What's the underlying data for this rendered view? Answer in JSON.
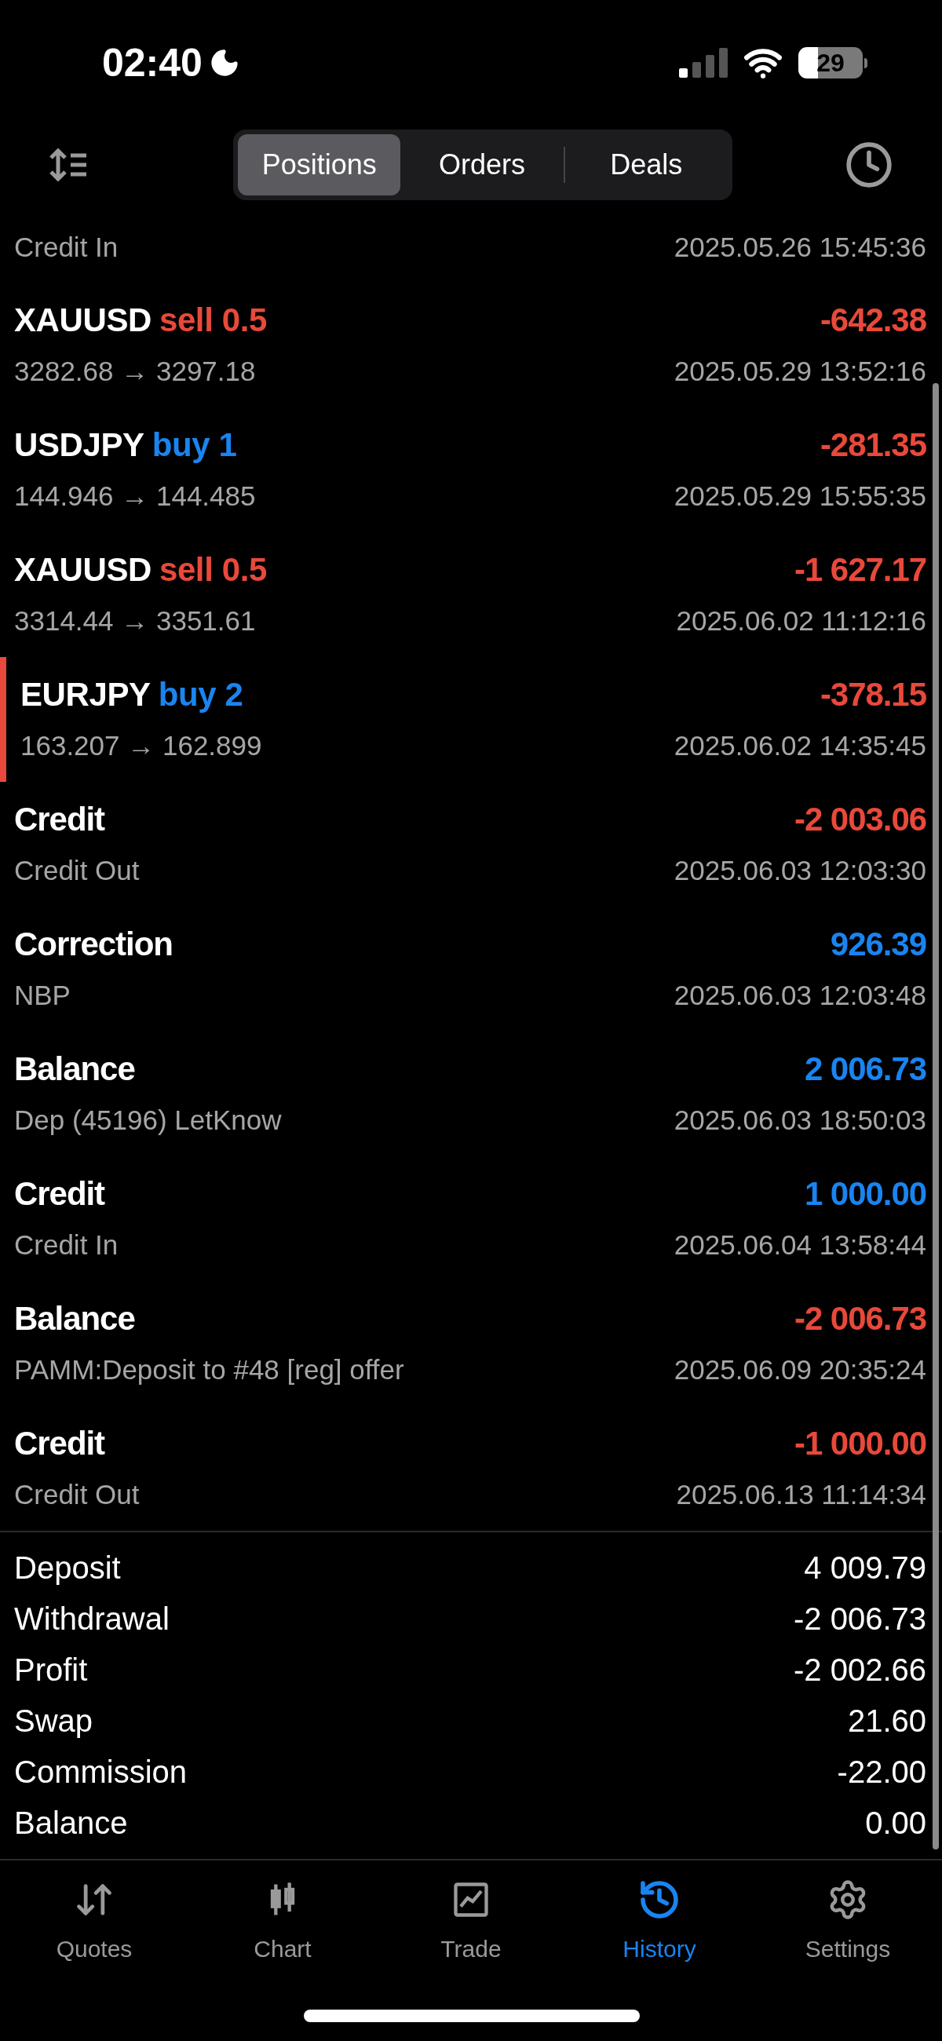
{
  "status_bar": {
    "time": "02:40",
    "battery": "29"
  },
  "segments": [
    {
      "label": "Positions",
      "selected": true
    },
    {
      "label": "Orders",
      "selected": false
    },
    {
      "label": "Deals",
      "selected": false
    }
  ],
  "deals": [
    {
      "kind": "balance",
      "comment": "Credit In",
      "time": "2025.05.26 15:45:36",
      "selected": false
    },
    {
      "kind": "trade",
      "symbol": "XAUUSD",
      "side": "sell",
      "volume": "0.5",
      "prices": "3282.68 → 3297.18",
      "value": "-642.38",
      "color": "#e8493a",
      "time": "2025.05.29 13:52:16",
      "selected": false
    },
    {
      "kind": "trade",
      "symbol": "USDJPY",
      "side": "buy",
      "volume": "1",
      "prices": "144.946 → 144.485",
      "value": "-281.35",
      "color": "#e8493a",
      "time": "2025.05.29 15:55:35",
      "selected": false
    },
    {
      "kind": "trade",
      "symbol": "XAUUSD",
      "side": "sell",
      "volume": "0.5",
      "prices": "3314.44 → 3351.61",
      "value": "-1 627.17",
      "color": "#e8493a",
      "time": "2025.06.02 11:12:16",
      "selected": false
    },
    {
      "kind": "trade",
      "symbol": "EURJPY",
      "side": "buy",
      "volume": "2",
      "prices": "163.207 → 162.899",
      "value": "-378.15",
      "color": "#e8493a",
      "time": "2025.06.02 14:35:45",
      "selected": true
    },
    {
      "kind": "balance",
      "title": "Credit",
      "comment": "Credit Out",
      "value": "-2 003.06",
      "color": "#e8493a",
      "time": "2025.06.03 12:03:30",
      "selected": false
    },
    {
      "kind": "balance",
      "title": "Correction",
      "comment": "NBP",
      "value": "926.39",
      "color": "#1a84f0",
      "time": "2025.06.03 12:03:48",
      "selected": false
    },
    {
      "kind": "balance",
      "title": "Balance",
      "comment": "Dep (45196) LetKnow",
      "value": "2 006.73",
      "color": "#1a84f0",
      "time": "2025.06.03 18:50:03",
      "selected": false
    },
    {
      "kind": "balance",
      "title": "Credit",
      "comment": "Credit In",
      "value": "1 000.00",
      "color": "#1a84f0",
      "time": "2025.06.04 13:58:44",
      "selected": false
    },
    {
      "kind": "balance",
      "title": "Balance",
      "comment": "PAMM:Deposit to #48 [reg] offer",
      "value": "-2 006.73",
      "color": "#e8493a",
      "time": "2025.06.09 20:35:24",
      "selected": false
    },
    {
      "kind": "balance",
      "title": "Credit",
      "comment": "Credit Out",
      "value": "-1 000.00",
      "color": "#e8493a",
      "time": "2025.06.13 11:14:34",
      "selected": false
    }
  ],
  "summary": [
    {
      "label": "Deposit",
      "value": "4 009.79"
    },
    {
      "label": "Withdrawal",
      "value": "-2 006.73"
    },
    {
      "label": "Profit",
      "value": "-2 002.66"
    },
    {
      "label": "Swap",
      "value": "21.60"
    },
    {
      "label": "Commission",
      "value": "-22.00"
    },
    {
      "label": "Balance",
      "value": "0.00"
    }
  ],
  "tab_bar": [
    {
      "kind": "quotes",
      "label": "Quotes",
      "selected": false
    },
    {
      "kind": "chart",
      "label": "Chart",
      "selected": false
    },
    {
      "kind": "trade",
      "label": "Trade",
      "selected": false
    },
    {
      "kind": "history",
      "label": "History",
      "selected": true
    },
    {
      "kind": "settings",
      "label": "Settings",
      "selected": false
    }
  ]
}
